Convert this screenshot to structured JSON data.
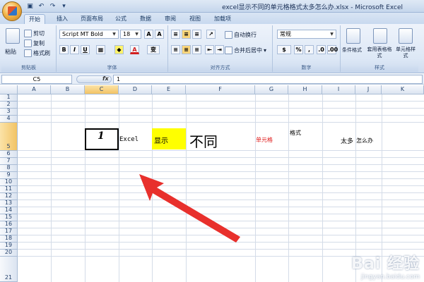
{
  "window": {
    "title": "excel显示不同的单元格格式太多怎么办.xlsx - Microsoft Excel"
  },
  "tabs": [
    "开始",
    "插入",
    "页面布局",
    "公式",
    "数据",
    "审阅",
    "视图",
    "加载项"
  ],
  "ribbon": {
    "clipboard": {
      "label": "剪贴板",
      "paste": "粘贴",
      "cut": "剪切",
      "copy": "复制",
      "format_painter": "格式刷"
    },
    "font": {
      "label": "字体",
      "font_name": "Script MT Bold",
      "font_size": "18",
      "bold": "B",
      "italic": "I",
      "underline": "U",
      "font_color": "A",
      "wen": "变"
    },
    "alignment": {
      "label": "对齐方式",
      "wrap": "自动换行",
      "merge": "合并后居中"
    },
    "number": {
      "label": "数字",
      "format": "常规",
      "percent": "%",
      "comma": ","
    },
    "styles": {
      "label": "样式",
      "conditional": "条件格式",
      "as_table": "套用表格格式",
      "cell_styles": "单元格样式"
    }
  },
  "formula_bar": {
    "name_box": "C5",
    "fx": "fx",
    "value": "1"
  },
  "grid": {
    "columns": [
      "A",
      "B",
      "C",
      "D",
      "E",
      "F",
      "G",
      "H",
      "I",
      "J",
      "K"
    ],
    "rows": [
      "1",
      "2",
      "3",
      "4",
      "5",
      "6",
      "7",
      "8",
      "9",
      "10",
      "11",
      "12",
      "13",
      "14",
      "15",
      "16",
      "17",
      "18",
      "19",
      "20",
      "21"
    ],
    "selected_column": "C",
    "selected_row": "5",
    "cells": {
      "C5": "1",
      "D5": "Excel",
      "E5": "显示",
      "F5": "不同",
      "G5": "单元格",
      "H5": "格式",
      "I5": "太多",
      "J5": "怎么办"
    }
  },
  "colors": {
    "highlight_yellow": "#ffff00",
    "red_text": "#e02020",
    "arrow_red": "#e8302c"
  },
  "watermark": {
    "brand": "Bai 经验",
    "sub": "jingyan.baidu.com"
  }
}
